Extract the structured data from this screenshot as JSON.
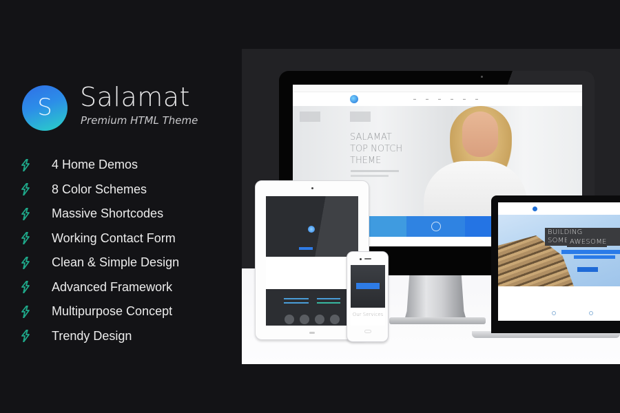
{
  "brand": {
    "logo_letter": "S",
    "name": "Salamat",
    "tagline": "Premium HTML Theme",
    "colors": {
      "logo_gradient_start": "#2f6fe6",
      "logo_gradient_end": "#2ad3c6",
      "bolt_icon": "#1fa98a",
      "background": "#131316"
    }
  },
  "features": [
    {
      "icon": "lightning-bolt-icon",
      "label": "4 Home Demos"
    },
    {
      "icon": "lightning-bolt-icon",
      "label": "8 Color Schemes"
    },
    {
      "icon": "lightning-bolt-icon",
      "label": "Massive Shortcodes"
    },
    {
      "icon": "lightning-bolt-icon",
      "label": "Working Contact Form"
    },
    {
      "icon": "lightning-bolt-icon",
      "label": "Clean & Simple Design"
    },
    {
      "icon": "lightning-bolt-icon",
      "label": "Advanced Framework"
    },
    {
      "icon": "lightning-bolt-icon",
      "label": "Multipurpose Concept"
    },
    {
      "icon": "lightning-bolt-icon",
      "label": "Trendy Design"
    }
  ],
  "showcase": {
    "monitor": {
      "hero_title": "SALAMAT\nTOP NOTCH\nTHEME",
      "accent": "#2a7be8"
    },
    "laptop": {
      "hero_title_line1": "BUILDING SOMETHING",
      "hero_title_line2": "AWESOME"
    },
    "phone": {
      "section_caption": "Our Services"
    }
  }
}
